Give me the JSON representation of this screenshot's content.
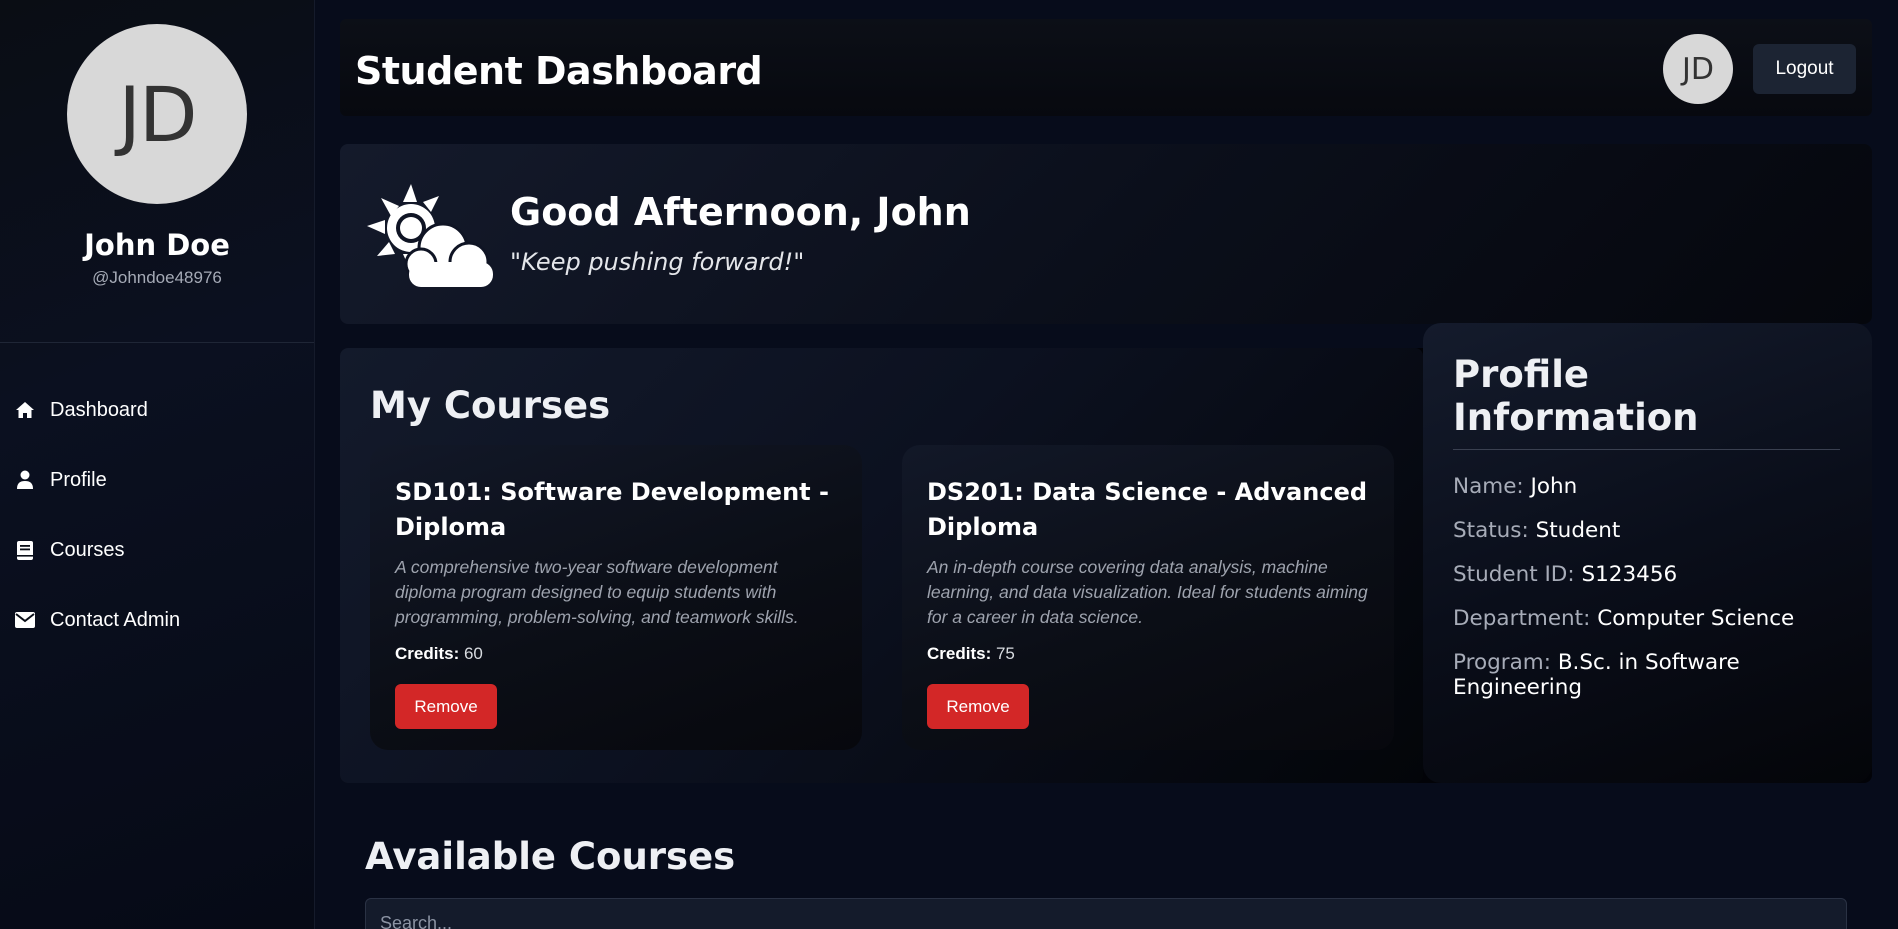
{
  "sidebar": {
    "avatar_initials": "JD",
    "name": "John Doe",
    "handle": "@Johndoe48976",
    "items": [
      {
        "label": "Dashboard",
        "icon": "home-icon"
      },
      {
        "label": "Profile",
        "icon": "user-icon"
      },
      {
        "label": "Courses",
        "icon": "book-icon"
      },
      {
        "label": "Contact Admin",
        "icon": "envelope-icon"
      }
    ]
  },
  "header": {
    "title": "Student Dashboard",
    "avatar_initials": "JD",
    "logout_label": "Logout"
  },
  "greeting": {
    "icon": "partly-cloudy-icon",
    "title": "Good Afternoon, John",
    "quote": "\"Keep pushing forward!\""
  },
  "my_courses": {
    "title": "My Courses",
    "courses": [
      {
        "title": "SD101: Software Development - Diploma",
        "description": "A comprehensive two-year software development diploma program designed to equip students with programming, problem-solving, and teamwork skills.",
        "credits_label": "Credits:",
        "credits": "60",
        "remove_label": "Remove"
      },
      {
        "title": "DS201: Data Science - Advanced Diploma",
        "description": "An in-depth course covering data analysis, machine learning, and data visualization. Ideal for students aiming for a career in data science.",
        "credits_label": "Credits:",
        "credits": "75",
        "remove_label": "Remove"
      }
    ]
  },
  "profile": {
    "title": "Profile Information",
    "rows": [
      {
        "label": "Name:",
        "value": "John"
      },
      {
        "label": "Status:",
        "value": "Student"
      },
      {
        "label": "Student ID:",
        "value": "S123456"
      },
      {
        "label": "Department:",
        "value": "Computer Science"
      },
      {
        "label": "Program:",
        "value": "B.Sc. in Software Engineering"
      }
    ]
  },
  "available_courses": {
    "title": "Available Courses",
    "search_placeholder": "Search..."
  },
  "colors": {
    "background": "#070c1b",
    "remove_button": "#d32727",
    "logout_button": "#1c2433"
  }
}
